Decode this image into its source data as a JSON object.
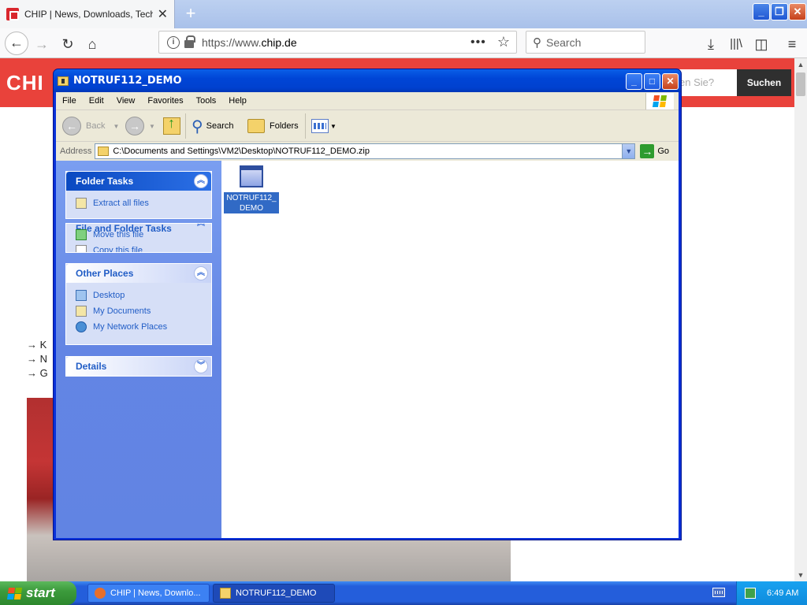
{
  "browser": {
    "tab_title": "CHIP | News, Downloads, Tech- &",
    "tab_close": "✕",
    "new_tab": "+",
    "url_scheme": "https://www.",
    "url_host": "chip.de",
    "search_placeholder": "Search"
  },
  "webpage": {
    "logo_text": "CHI",
    "search_placeholder": "en Sie?",
    "search_button": "Suchen",
    "links": [
      "→ K",
      "→ N",
      "→ G"
    ]
  },
  "explorer": {
    "title": "NOTRUF112_DEMO",
    "menu": [
      "File",
      "Edit",
      "View",
      "Favorites",
      "Tools",
      "Help"
    ],
    "toolbar": {
      "back": "Back",
      "search": "Search",
      "folders": "Folders"
    },
    "address_label": "Address",
    "address_value": "C:\\Documents and Settings\\VM2\\Desktop\\NOTRUF112_DEMO.zip",
    "go_label": "Go",
    "folder_tasks": {
      "title": "Folder Tasks",
      "items": [
        "Extract all files"
      ]
    },
    "file_tasks": {
      "title": "File and Folder Tasks",
      "items": [
        "Move this file",
        "Copy this file"
      ]
    },
    "other_places": {
      "title": "Other Places",
      "items": [
        "Desktop",
        "My Documents",
        "My Network Places"
      ]
    },
    "details": {
      "title": "Details"
    },
    "file_item": {
      "label_line1": "NOTRUF112_",
      "label_line2": "DEMO"
    }
  },
  "taskbar": {
    "start_label": "start",
    "tasks": [
      "CHIP | News, Downlo...",
      "NOTRUF112_DEMO"
    ],
    "clock": "6:49 AM"
  },
  "colors": {
    "xp_blue": "#0831d9",
    "chip_red": "#e9423b",
    "selection": "#316ac5"
  }
}
